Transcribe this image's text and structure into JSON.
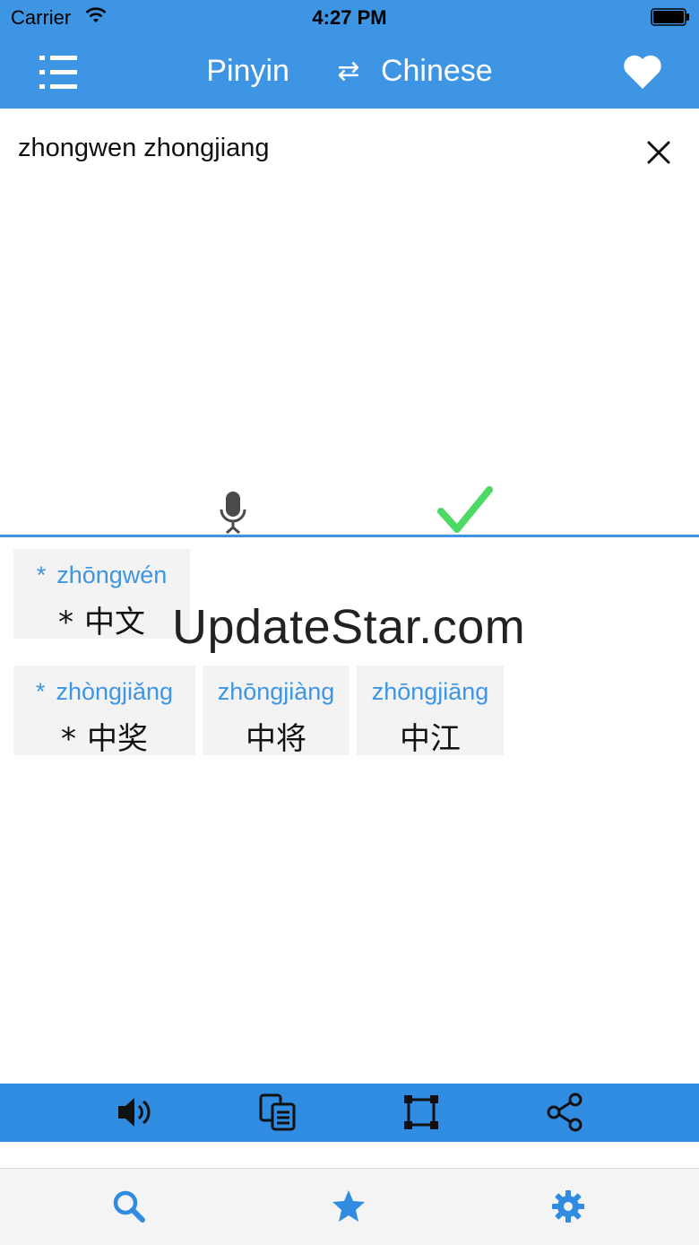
{
  "status_bar": {
    "carrier": "Carrier",
    "time": "4:27 PM"
  },
  "nav": {
    "source_lang": "Pinyin",
    "swap_symbol": "⇄",
    "target_lang": "Chinese"
  },
  "input": {
    "text": "zhongwen zhongjiang"
  },
  "results": [
    {
      "pinyin": "zhōngwén",
      "hanzi": "中文",
      "starred": true
    },
    {
      "pinyin": "zhòngjiǎng",
      "hanzi": "中奖",
      "starred": true
    },
    {
      "pinyin": "zhōngjiàng",
      "hanzi": "中将",
      "starred": false
    },
    {
      "pinyin": "zhōngjiāng",
      "hanzi": "中江",
      "starred": false
    }
  ],
  "star_mark": "*",
  "watermark": "UpdateStar.com",
  "toolbar_icons": [
    "speaker-icon",
    "copy-icon",
    "fullscreen-icon",
    "share-icon"
  ],
  "tab_icons": [
    "search-icon",
    "star-icon",
    "gear-icon"
  ],
  "colors": {
    "accent": "#3d95e3",
    "toolbar": "#2f8ce0",
    "check": "#4cd964",
    "card": "#f3f3f3"
  }
}
